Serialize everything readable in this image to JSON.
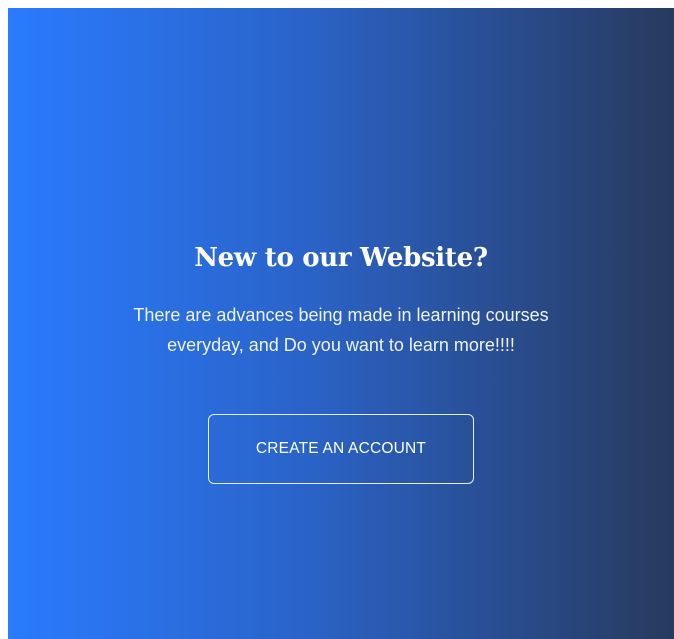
{
  "cta_panel": {
    "title": "New to our Website?",
    "description": "There are advances being made in learning courses everyday, and Do you want to learn more!!!!",
    "button_label": "CREATE AN ACCOUNT"
  },
  "colors": {
    "gradient_start": "#2a7bff",
    "gradient_end": "#283a5e",
    "text": "#ffffff",
    "button_border": "#e8eef9"
  }
}
